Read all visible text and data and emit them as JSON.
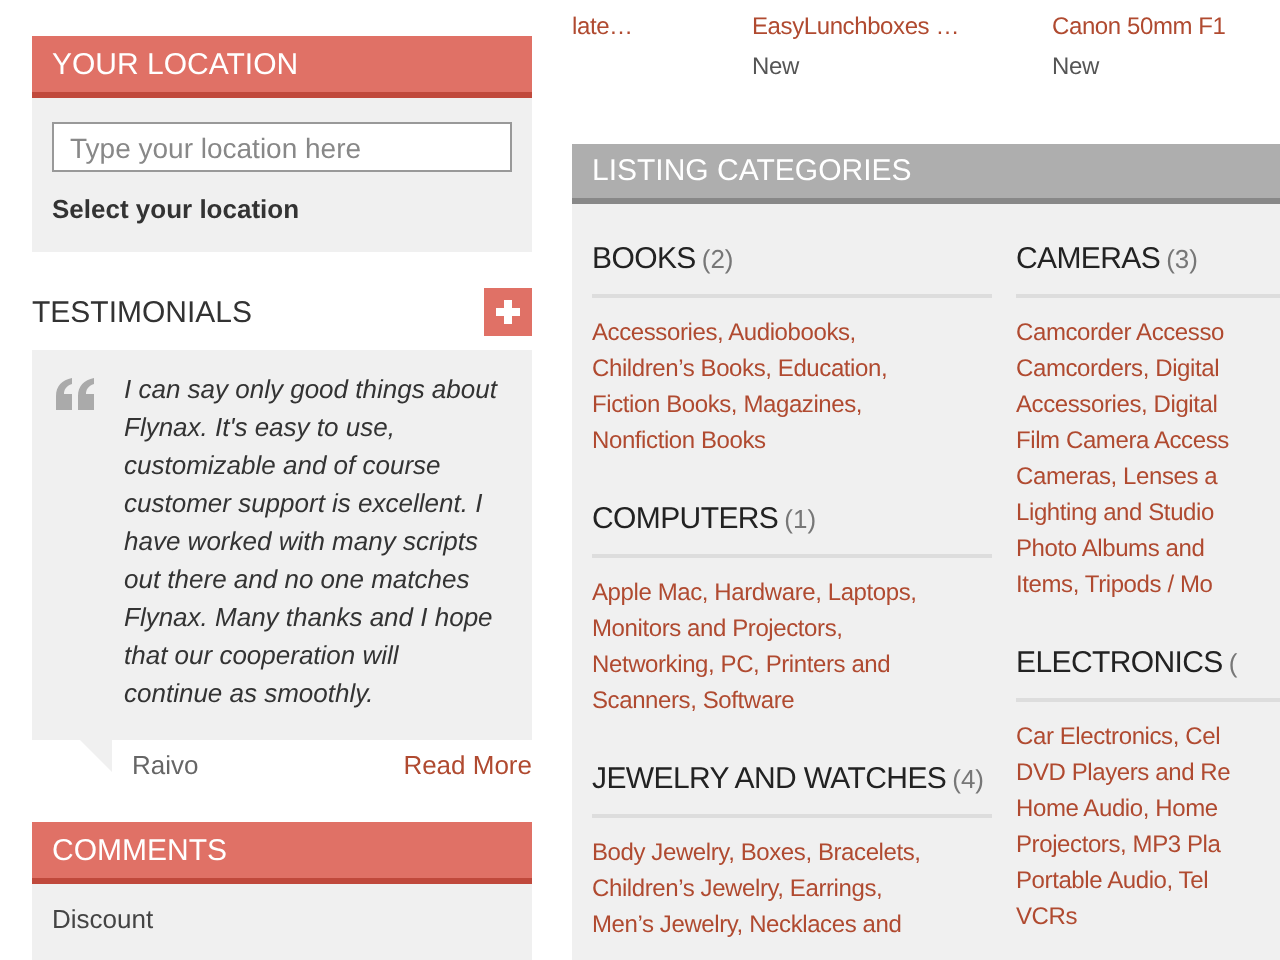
{
  "location": {
    "title": "YOUR LOCATION",
    "placeholder": "Type your location here",
    "link": "Select your location"
  },
  "testimonials": {
    "title": "TESTIMONIALS",
    "quote": "I can say only good things about Flynax. It's easy to use, customizable and of course customer support is excellent. I have worked with many scripts out there and no one matches Flynax. Many thanks and I hope that our cooperation will continue as smoothly.",
    "author": "Raivo",
    "more": "Read More"
  },
  "comments": {
    "title": "COMMENTS",
    "items": [
      "Discount"
    ]
  },
  "listings": [
    {
      "title": "late…"
    },
    {
      "title": "EasyLunchboxes …",
      "status": "New"
    },
    {
      "title": "Canon 50mm F1",
      "status": "New"
    }
  ],
  "categories": {
    "title": "LISTING CATEGORIES",
    "columns": [
      [
        {
          "name": "BOOKS",
          "count": "(2)",
          "lines": [
            "Accessories, Audiobooks,",
            "Children’s Books, Education,",
            "Fiction Books, Magazines,",
            "Nonfiction Books"
          ]
        },
        {
          "name": "COMPUTERS",
          "count": "(1)",
          "lines": [
            "Apple Mac, Hardware, Laptops,",
            "Monitors and Projectors,",
            "Networking, PC, Printers and",
            "Scanners, Software"
          ]
        },
        {
          "name": "JEWELRY AND WATCHES",
          "count": "(4)",
          "lines": [
            "Body Jewelry, Boxes, Bracelets,",
            "Children’s Jewelry, Earrings,",
            "Men’s Jewelry, Necklaces and"
          ]
        }
      ],
      [
        {
          "name": "CAMERAS",
          "count": "(3)",
          "lines": [
            "Camcorder Accesso",
            "Camcorders, Digital",
            "Accessories, Digital",
            "Film Camera Access",
            "Cameras, Lenses a",
            "Lighting and Studio",
            "Photo Albums and",
            "Items, Tripods / Mo"
          ]
        },
        {
          "name": "ELECTRONICS",
          "count": "(",
          "lines": [
            "Car Electronics, Cel",
            "DVD Players and Re",
            "Home Audio, Home",
            "Projectors, MP3 Pla",
            "Portable Audio, Tel",
            "VCRs"
          ]
        }
      ]
    ]
  }
}
